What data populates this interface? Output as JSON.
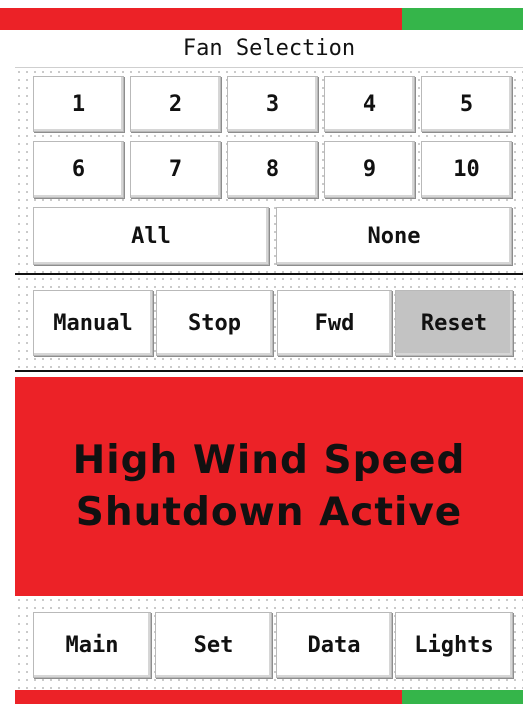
{
  "panel_title": "Fan Selection",
  "fans": [
    "1",
    "2",
    "3",
    "4",
    "5",
    "6",
    "7",
    "8",
    "9",
    "10"
  ],
  "selection": {
    "all_label": "All",
    "none_label": "None"
  },
  "mode_buttons": {
    "manual": "Manual",
    "stop": "Stop",
    "fwd": "Fwd",
    "reset": "Reset"
  },
  "alarm": {
    "line1": "High Wind Speed",
    "line2": "Shutdown Active"
  },
  "nav": {
    "main": "Main",
    "set": "Set",
    "data": "Data",
    "lights": "Lights"
  },
  "colors": {
    "status_red": "#ec2227",
    "status_green": "#35b54a",
    "alarm_bg": "#ec2227",
    "pressed_button": "#c3c3c3"
  }
}
